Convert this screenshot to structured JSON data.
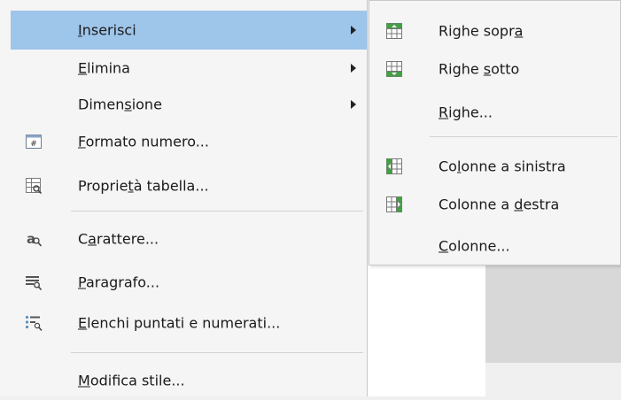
{
  "colors": {
    "highlight": "#9ec5ea",
    "menu_bg": "#f5f5f5",
    "table_icon_green": "#3fa33f"
  },
  "menu": {
    "items": [
      {
        "label": "Inserisci",
        "mnemonic": "I",
        "has_submenu": true,
        "icon": null,
        "highlighted": true
      },
      {
        "label": "Elimina",
        "mnemonic": "E",
        "has_submenu": true,
        "icon": null
      },
      {
        "label": "Dimensione",
        "mnemonic": "s",
        "has_submenu": true,
        "icon": null
      },
      {
        "label": "Formato numero...",
        "mnemonic": "F",
        "has_submenu": false,
        "icon": "number-format-icon"
      },
      {
        "label": "Proprietà tabella...",
        "mnemonic": "t",
        "has_submenu": false,
        "icon": "table-properties-icon"
      },
      {
        "label": "Carattere...",
        "mnemonic": "a",
        "has_submenu": false,
        "icon": "character-icon"
      },
      {
        "label": "Paragrafo...",
        "mnemonic": "P",
        "has_submenu": false,
        "icon": "paragraph-icon"
      },
      {
        "label": "Elenchi puntati e numerati...",
        "mnemonic": "E",
        "has_submenu": false,
        "icon": "bullets-numbering-icon"
      },
      {
        "label": "Modifica stile...",
        "mnemonic": "M",
        "has_submenu": false,
        "icon": null
      }
    ]
  },
  "submenu": {
    "parent": "Inserisci",
    "items": [
      {
        "label": "Righe sopra",
        "mnemonic": "a",
        "icon": "insert-rows-above-icon"
      },
      {
        "label": "Righe sotto",
        "mnemonic": "s",
        "icon": "insert-rows-below-icon"
      },
      {
        "label": "Righe...",
        "mnemonic": "R",
        "icon": null
      },
      {
        "label": "Colonne a sinistra",
        "mnemonic": "l",
        "icon": "insert-columns-left-icon"
      },
      {
        "label": "Colonne a destra",
        "mnemonic": "d",
        "icon": "insert-columns-right-icon"
      },
      {
        "label": "Colonne...",
        "mnemonic": "C",
        "icon": null
      }
    ]
  }
}
